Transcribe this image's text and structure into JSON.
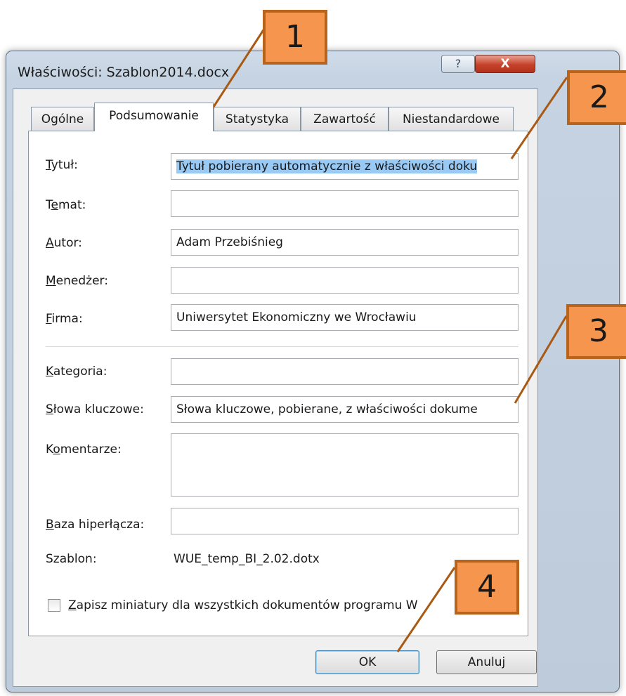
{
  "window": {
    "title": "Właściwości: Szablon2014.docx",
    "help_glyph": "?",
    "close_glyph": "X"
  },
  "tabs": [
    {
      "label": "Ogólne",
      "active": false
    },
    {
      "label": "Podsumowanie",
      "active": true
    },
    {
      "label": "Statystyka",
      "active": false
    },
    {
      "label": "Zawartość",
      "active": false
    },
    {
      "label": "Niestandardowe",
      "active": false
    }
  ],
  "fields": {
    "title": {
      "label_mnemonic": "T",
      "label_rest": "ytuł:",
      "value": "Tytuł pobierany automatycznie z właściwości doku"
    },
    "subject": {
      "label_pre": "T",
      "label_mnemonic": "e",
      "label_rest": "mat:",
      "value": ""
    },
    "author": {
      "label_mnemonic": "A",
      "label_rest": "utor:",
      "value": "Adam Przebiśnieg"
    },
    "manager": {
      "label_mnemonic": "M",
      "label_rest": "enedżer:",
      "value": ""
    },
    "company": {
      "label_mnemonic": "F",
      "label_rest": "irma:",
      "value": "Uniwersytet Ekonomiczny we Wrocławiu"
    },
    "category": {
      "label_mnemonic": "K",
      "label_rest": "ategoria:",
      "value": ""
    },
    "keywords": {
      "label_mnemonic": "S",
      "label_rest": "łowa kluczowe:",
      "value": "Słowa kluczowe, pobierane, z właściwości dokume"
    },
    "comments": {
      "label_pre": "K",
      "label_mnemonic": "o",
      "label_rest": "mentarze:",
      "value": ""
    },
    "hyperlink_base": {
      "label_mnemonic": "B",
      "label_rest": "aza hiperłącza:",
      "value": ""
    },
    "template": {
      "label": "Szablon:",
      "value": "WUE_temp_BI_2.02.dotx"
    }
  },
  "checkbox": {
    "checked": false,
    "label_mnemonic": "Z",
    "label_rest": "apisz miniatury dla wszystkich dokumentów programu W"
  },
  "buttons": {
    "ok": "OK",
    "cancel": "Anuluj"
  },
  "callouts": [
    "1",
    "2",
    "3",
    "4"
  ],
  "colors": {
    "callout_fill": "#f5954e",
    "callout_border": "#b8641c",
    "pointer_line": "#a85a14",
    "selection": "#99c9f5",
    "close_button": "#c5412a"
  }
}
